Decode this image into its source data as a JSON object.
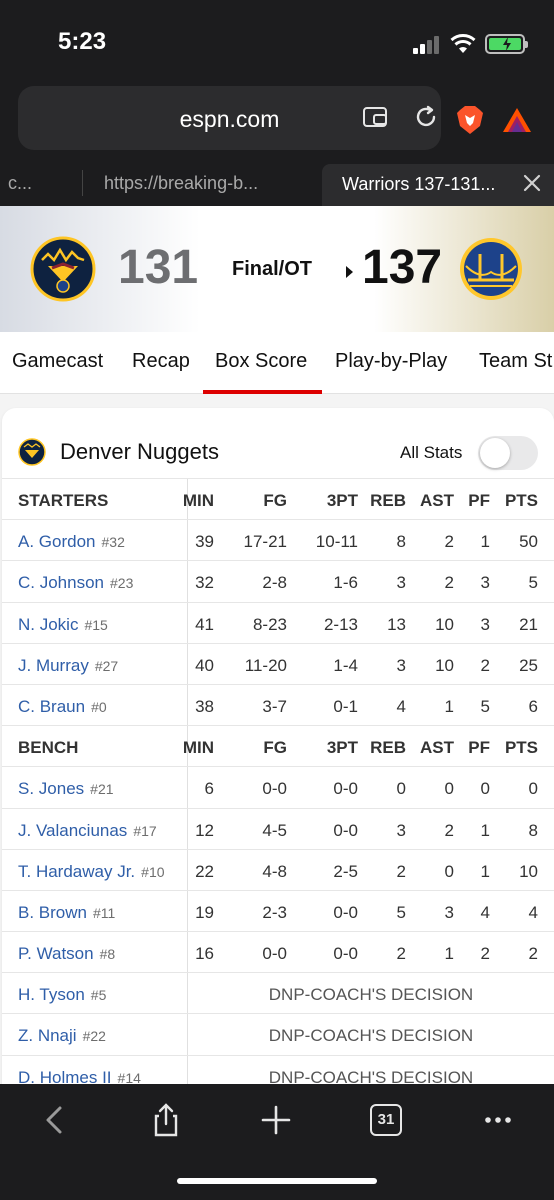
{
  "status": {
    "time": "5:23"
  },
  "browser": {
    "url": "espn.com",
    "tabs": {
      "left_partial": "c...",
      "middle": "https://breaking-b...",
      "active": "Warriors 137-131..."
    },
    "tab_count": "31"
  },
  "game": {
    "away_score": "131",
    "home_score": "137",
    "status": "Final/OT"
  },
  "nav": {
    "items": [
      "Gamecast",
      "Recap",
      "Box Score",
      "Play-by-Play",
      "Team St"
    ],
    "active": "Box Score"
  },
  "boxscore": {
    "team": "Denver Nuggets",
    "all_stats_label": "All Stats",
    "all_stats_on": false,
    "columns": [
      "MIN",
      "FG",
      "3PT",
      "REB",
      "AST",
      "PF",
      "PTS"
    ],
    "starters_label": "STARTERS",
    "bench_label": "BENCH",
    "starters": [
      {
        "name": "A. Gordon",
        "number": "#32",
        "stats": [
          "39",
          "17-21",
          "10-11",
          "8",
          "2",
          "1",
          "50"
        ]
      },
      {
        "name": "C. Johnson",
        "number": "#23",
        "stats": [
          "32",
          "2-8",
          "1-6",
          "3",
          "2",
          "3",
          "5"
        ]
      },
      {
        "name": "N. Jokic",
        "number": "#15",
        "stats": [
          "41",
          "8-23",
          "2-13",
          "13",
          "10",
          "3",
          "21"
        ]
      },
      {
        "name": "J. Murray",
        "number": "#27",
        "stats": [
          "40",
          "11-20",
          "1-4",
          "3",
          "10",
          "2",
          "25"
        ]
      },
      {
        "name": "C. Braun",
        "number": "#0",
        "stats": [
          "38",
          "3-7",
          "0-1",
          "4",
          "1",
          "5",
          "6"
        ]
      }
    ],
    "bench": [
      {
        "name": "S. Jones",
        "number": "#21",
        "stats": [
          "6",
          "0-0",
          "0-0",
          "0",
          "0",
          "0",
          "0"
        ]
      },
      {
        "name": "J. Valanciunas",
        "number": "#17",
        "stats": [
          "12",
          "4-5",
          "0-0",
          "3",
          "2",
          "1",
          "8"
        ]
      },
      {
        "name": "T. Hardaway Jr.",
        "number": "#10",
        "stats": [
          "22",
          "4-8",
          "2-5",
          "2",
          "0",
          "1",
          "10"
        ]
      },
      {
        "name": "B. Brown",
        "number": "#11",
        "stats": [
          "19",
          "2-3",
          "0-0",
          "5",
          "3",
          "4",
          "4"
        ]
      },
      {
        "name": "P. Watson",
        "number": "#8",
        "stats": [
          "16",
          "0-0",
          "0-0",
          "2",
          "1",
          "2",
          "2"
        ]
      },
      {
        "name": "H. Tyson",
        "number": "#5",
        "dnp": "DNP-COACH'S DECISION"
      },
      {
        "name": "Z. Nnaji",
        "number": "#22",
        "dnp": "DNP-COACH'S DECISION"
      },
      {
        "name": "D. Holmes II",
        "number": "#14",
        "dnp": "DNP-COACH'S DECISION"
      }
    ]
  },
  "colors": {
    "link": "#2f5ea8",
    "accent_underline": "#dd0000",
    "nuggets_navy": "#0e2240",
    "nuggets_gold": "#fec524",
    "warriors_blue": "#1d428a",
    "warriors_gold": "#ffc72c"
  },
  "icons": [
    "signal-icon",
    "wifi-icon",
    "battery-icon",
    "wallet-icon",
    "reload-icon",
    "brave-icon",
    "bat-icon",
    "close-icon",
    "back-icon",
    "share-icon",
    "new-tab-icon",
    "tabs-icon",
    "more-icon"
  ]
}
